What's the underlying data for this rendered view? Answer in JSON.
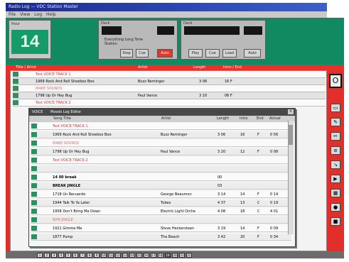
{
  "window": {
    "title": "Radio Log — VDC Station Master"
  },
  "menu": [
    "File",
    "View",
    "Log",
    "Help"
  ],
  "hour_box": {
    "label": "Hour",
    "value": "14"
  },
  "deck1": {
    "label": "Deck",
    "cue_line1": "Everything Long Tone",
    "cue_line2": "Station",
    "buttons": [
      "Stop",
      "Cue",
      "Auto"
    ]
  },
  "deck2": {
    "label": "Deck",
    "buttons": [
      "Play",
      "Cue",
      "Load",
      "Auto"
    ]
  },
  "log_header": {
    "col1": "Title / Artist",
    "col2": "Artist",
    "col3": "Length",
    "col4": "Intro / End"
  },
  "log_rows": [
    {
      "title": "Test VOICE TRACK 1",
      "artist": "",
      "len": "",
      "ie": "",
      "style": "vt"
    },
    {
      "title": "1969 Rock And Roll Shoebox Boo",
      "artist": "Buzz Reminger",
      "len": "3 06",
      "ie": "16  F",
      "style": "normal"
    },
    {
      "title": "MAKE SOUNDS",
      "artist": "",
      "len": "",
      "ie": "",
      "style": "pink"
    },
    {
      "title": "1798 Up Or Hey Bug",
      "artist": "Paul Vance",
      "len": "3 10",
      "ie": "06  F",
      "style": "normal"
    },
    {
      "title": "Test VOICE TRACK 2",
      "artist": "",
      "len": "",
      "ie": "",
      "style": "vt"
    }
  ],
  "pane": {
    "tab": "Moods Log Editor",
    "headers": {
      "title": "Song Title",
      "artist": "Artist",
      "length": "Length",
      "intro": "Intro",
      "end": "End",
      "actual": "Actual"
    },
    "rows": [
      {
        "title": "Test VOICE TRACK 1",
        "artist": "",
        "len": "",
        "intro": "",
        "end": "",
        "act": "",
        "style": "vt"
      },
      {
        "title": "1969 Rock And Roll Shoebox Boo",
        "artist": "Buzz Reminger",
        "len": "3 06",
        "intro": "16",
        "end": "F",
        "act": "0 56",
        "style": "normal"
      },
      {
        "title": "MAKE SOUNDS",
        "artist": "",
        "len": "",
        "intro": "",
        "end": "",
        "act": "",
        "style": "pink"
      },
      {
        "title": "1798 Up Or Hey Bug",
        "artist": "Paul Vance",
        "len": "3 20",
        "intro": "12",
        "end": "F",
        "act": "0 08",
        "style": "normal"
      },
      {
        "title": "Test VOICE TRACK 2",
        "artist": "",
        "len": "",
        "intro": "",
        "end": "",
        "act": "",
        "style": "vt"
      },
      {
        "title": "",
        "artist": "",
        "len": "",
        "intro": "",
        "end": "",
        "act": "",
        "style": "normal"
      },
      {
        "title": "14 00  break",
        "artist": "",
        "len": "00",
        "intro": "",
        "end": "",
        "act": "",
        "style": "bold"
      },
      {
        "title": "BREAK JINGLE",
        "artist": "",
        "len": "03",
        "intro": "",
        "end": "",
        "act": "",
        "style": "bold"
      },
      {
        "title": "1718 Un Recuerdo",
        "artist": "George Beaumon",
        "len": "3 14",
        "intro": "14",
        "end": "F",
        "act": "0 14",
        "style": "normal"
      },
      {
        "title": "1944 Talk To Ya Later",
        "artist": "Tubes",
        "len": "4 37",
        "intro": "13",
        "end": "C",
        "act": "0 19",
        "style": "normal"
      },
      {
        "title": "1958 Don't Bring Me Down",
        "artist": "Electric Light Orche",
        "len": "4 08",
        "intro": "18",
        "end": "C",
        "act": "4 01",
        "style": "normal"
      },
      {
        "title": "BPM JINGLE",
        "artist": "",
        "len": "",
        "intro": "",
        "end": "",
        "act": "",
        "style": "pink"
      },
      {
        "title": "1921 Gimme Me",
        "artist": "Steve Heckersteen",
        "len": "3 19",
        "intro": "14",
        "end": "F",
        "act": "0 09",
        "style": "normal"
      },
      {
        "title": "1877 Pump",
        "artist": "The Beach",
        "len": "3 42",
        "intro": "20",
        "end": "F",
        "act": "0 34",
        "style": "normal"
      }
    ]
  },
  "pager": [
    "1",
    "2",
    "3",
    "4",
    "5",
    "6",
    "7",
    "8",
    "9",
    "10",
    "11",
    "12",
    "13",
    "14",
    "15",
    "16",
    "17",
    "18",
    "19",
    "20",
    "21",
    "22"
  ],
  "pager_selected": "19",
  "right_tool": {
    "selected_icon": "O"
  },
  "colors": {
    "panel_green": "#118a62",
    "accent_red": "#e1302a",
    "title_blue": "#1b2a92"
  }
}
